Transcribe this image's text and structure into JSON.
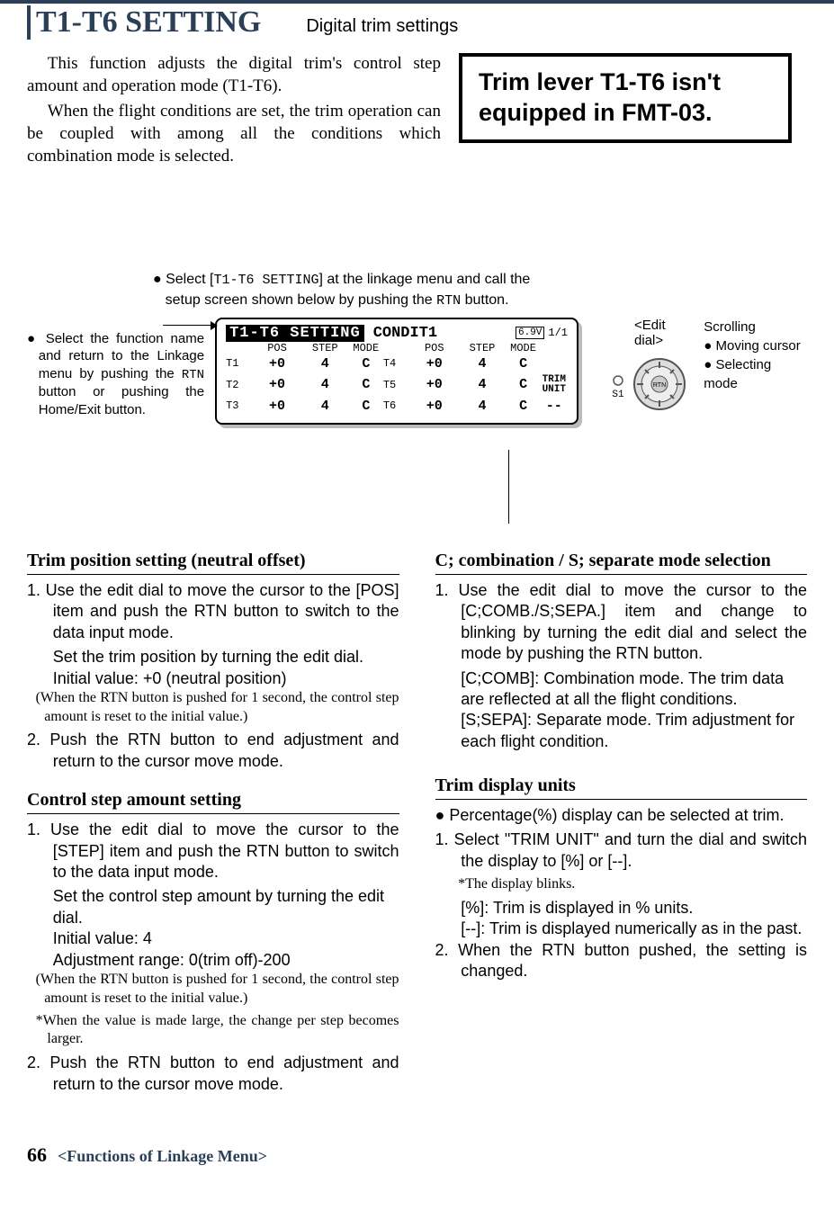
{
  "header": {
    "title": "T1-T6 SETTING",
    "subtitle": "Digital trim settings"
  },
  "intro": {
    "p1": "This function adjusts the digital trim's control step amount and operation mode (T1-T6).",
    "p2": "When the flight conditions are set, the trim operation can be coupled with among all the conditions which combination mode is selected."
  },
  "callout": "Trim lever T1-T6 isn't equipped in FMT-03.",
  "mid_note_pre": "● Select [",
  "mid_note_code": "T1-T6 SETTING",
  "mid_note_post": "] at the linkage menu and call the setup screen shown below by pushing the ",
  "mid_note_code2": "RTN",
  "mid_note_end": " button.",
  "left_note_pre": "● Select the function name and return to the Linkage menu by pushing the ",
  "left_note_code": "RTN",
  "left_note_post": " button or pushing the Home/Exit button.",
  "lcd": {
    "title": "T1-T6 SETTING",
    "cond": "CONDIT1",
    "batt": "6.9V",
    "page": "1/1",
    "cols": {
      "pos": "POS",
      "step": "STEP",
      "mode": "MODE"
    },
    "trim_unit": "TRIM UNIT",
    "dash": "--",
    "rows": [
      {
        "l": "T1",
        "lpos": "+0",
        "lstep": "4",
        "lmode": "C",
        "r": "T4",
        "rpos": "+0",
        "rstep": "4",
        "rmode": "C"
      },
      {
        "l": "T2",
        "lpos": "+0",
        "lstep": "4",
        "lmode": "C",
        "r": "T5",
        "rpos": "+0",
        "rstep": "4",
        "rmode": "C"
      },
      {
        "l": "T3",
        "lpos": "+0",
        "lstep": "4",
        "lmode": "C",
        "r": "T6",
        "rpos": "+0",
        "rstep": "4",
        "rmode": "C"
      }
    ]
  },
  "dial": {
    "label": "<Edit dial>",
    "s1": "S1",
    "scrolling": "Scrolling",
    "b1": "● Moving cursor",
    "b2": "● Selecting mode"
  },
  "left_col": {
    "h1": "Trim position setting (neutral offset)",
    "s1_1": "1. Use the edit dial to move the cursor to the [POS] item and push the RTN button to switch to the data input mode.",
    "s1_2": "Set the trim position by turning the edit dial.",
    "s1_3": "Initial value: +0 (neutral position)",
    "s1_note": "(When the RTN button is pushed for 1 second, the control step amount is reset to the initial value.)",
    "s1_4": "2. Push the RTN button to end adjustment and return to the cursor move mode.",
    "h2": "Control step amount setting",
    "s2_1": "1. Use the edit dial to move the cursor to the [STEP] item and push the RTN button to switch to the data input mode.",
    "s2_2": "Set the control step amount by turning the edit dial.",
    "s2_3": "Initial value: 4",
    "s2_4": "Adjustment range: 0(trim off)-200",
    "s2_note1": "(When the RTN button is pushed for 1 second, the control step amount is reset to the initial value.)",
    "s2_note2": "*When the value is made large, the change per step becomes larger.",
    "s2_5": "2. Push the RTN button to end adjustment and return to the cursor move mode."
  },
  "right_col": {
    "h1": "C; combination / S; separate mode selection",
    "r1_1": "1. Use the edit dial to move the cursor to the [C;COMB./S;SEPA.] item and change to blinking by turning the edit dial and select the mode by pushing the RTN button.",
    "r1_2": "[C;COMB]: Combination mode. The trim data are reflected at all the flight conditions.",
    "r1_3": "[S;SEPA]: Separate mode. Trim adjustment for each flight condition.",
    "h2": "Trim display units",
    "r2_b": "● Percentage(%) display can be selected at trim.",
    "r2_1": "1. Select \"TRIM UNIT\" and turn the dial and switch the display to [%] or [--].",
    "r2_note": "*The display blinks.",
    "r2_2": "[%]: Trim is displayed in % units.",
    "r2_3": "[--]: Trim is displayed numerically as in the past.",
    "r2_4": "2. When the RTN button pushed, the setting is changed."
  },
  "footer": {
    "page": "66",
    "text": "<Functions of Linkage Menu>"
  }
}
